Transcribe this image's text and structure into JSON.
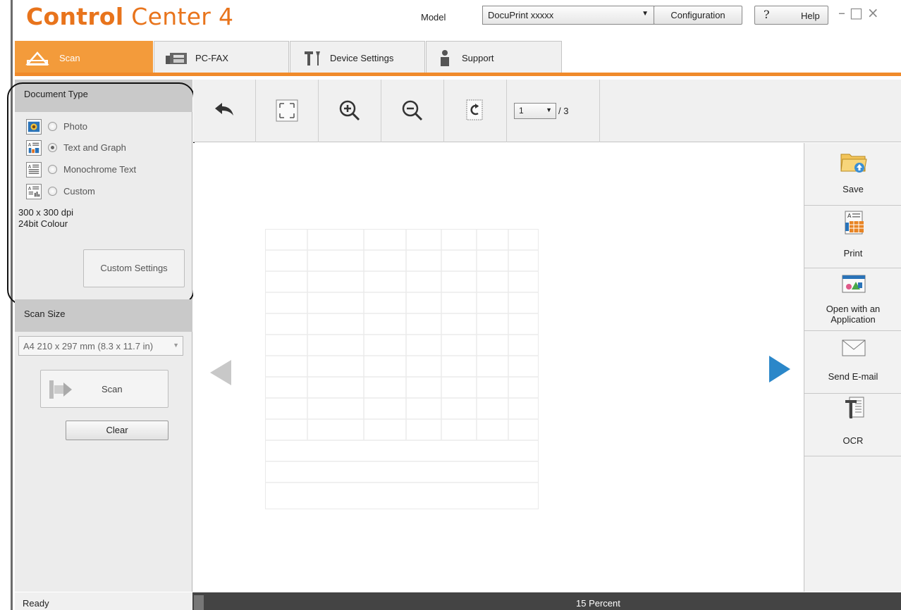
{
  "app": {
    "title_bold": "Control",
    "title_rest": " Center 4"
  },
  "header": {
    "model_label": "Model",
    "model_value": "DocuPrint xxxxx",
    "configuration_label": "Configuration",
    "help_mark": "?",
    "help_label": "Help",
    "window_controls": "–□×"
  },
  "tabs": [
    {
      "label": "Scan",
      "icon": "scan-icon",
      "active": true
    },
    {
      "label": "PC-FAX",
      "icon": "fax-icon",
      "active": false
    },
    {
      "label": "Device Settings",
      "icon": "tools-icon",
      "active": false
    },
    {
      "label": "Support",
      "icon": "person-icon",
      "active": false
    }
  ],
  "document_type": {
    "heading": "Document Type",
    "options": [
      {
        "label": "Photo",
        "icon": "photo-icon",
        "selected": false
      },
      {
        "label": "Text and Graph",
        "icon": "text-graph-icon",
        "selected": true
      },
      {
        "label": "Monochrome Text",
        "icon": "mono-text-icon",
        "selected": false
      },
      {
        "label": "Custom",
        "icon": "custom-doc-icon",
        "selected": false
      }
    ],
    "resolution": "300 x 300 dpi",
    "colour": "24bit Colour",
    "custom_settings_label": "Custom Settings"
  },
  "scan_size": {
    "heading": "Scan Size",
    "selected": "A4 210 x 297 mm (8.3 x 11.7 in)",
    "scan_label": "Scan",
    "clear_label": "Clear"
  },
  "toolbar": {
    "buttons": [
      "undo-icon",
      "fit-icon",
      "zoom-in-icon",
      "zoom-out-icon",
      "rotate-icon"
    ],
    "page_current": "1",
    "page_total": "/ 3"
  },
  "actions": [
    {
      "label": "Save",
      "icon": "folder-save-icon"
    },
    {
      "label": "Print",
      "icon": "print-icon"
    },
    {
      "label": "Open with an Application",
      "icon": "application-icon"
    },
    {
      "label": "Send E-mail",
      "icon": "envelope-icon"
    },
    {
      "label": "OCR",
      "icon": "ocr-icon"
    }
  ],
  "status": {
    "left": "Ready",
    "zoom": "15 Percent"
  },
  "colors": {
    "accent": "#f08a2a",
    "active_tab": "#f39b3b",
    "nav_arrow": "#2b87c9"
  }
}
